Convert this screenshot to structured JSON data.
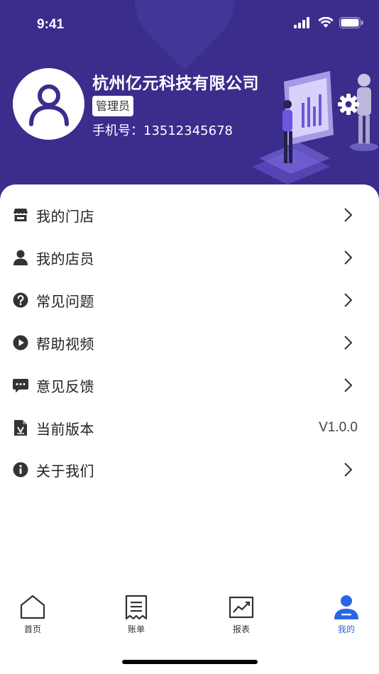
{
  "status_bar": {
    "time": "9:41"
  },
  "profile": {
    "company": "杭州亿元科技有限公司",
    "role": "管理员",
    "phone": "手机号：13512345678"
  },
  "menu": [
    {
      "label": "我的门店",
      "icon": "store-icon"
    },
    {
      "label": "我的店员",
      "icon": "person-icon"
    },
    {
      "label": "常见问题",
      "icon": "question-icon"
    },
    {
      "label": "帮助视频",
      "icon": "play-icon"
    },
    {
      "label": "意见反馈",
      "icon": "chat-icon"
    },
    {
      "label": "当前版本",
      "icon": "version-doc-icon",
      "value": "V1.0.0"
    },
    {
      "label": "关于我们",
      "icon": "info-icon"
    }
  ],
  "tabs": [
    {
      "label": "首页",
      "icon": "home-icon"
    },
    {
      "label": "账单",
      "icon": "bill-icon"
    },
    {
      "label": "报表",
      "icon": "chart-icon"
    },
    {
      "label": "我的",
      "icon": "profile-icon",
      "active": true
    }
  ],
  "colors": {
    "header_bg": "#3a2d8c",
    "active_tab": "#2a65e8",
    "icon_dark": "#333333"
  }
}
